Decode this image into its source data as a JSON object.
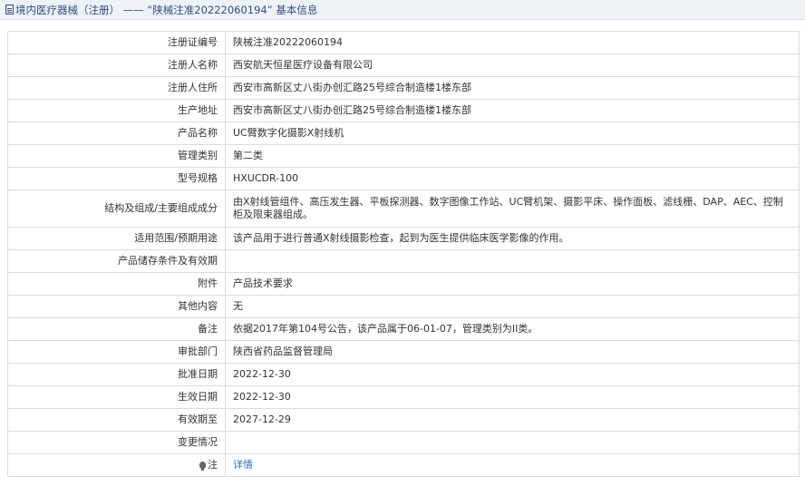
{
  "header": {
    "title": "境内医疗器械（注册） —— “陕械注准20222060194” 基本信息"
  },
  "rows": [
    {
      "label": "注册证编号",
      "value": "陕械注准20222060194"
    },
    {
      "label": "注册人名称",
      "value": "西安航天恒星医疗设备有限公司"
    },
    {
      "label": "注册人住所",
      "value": "西安市高新区丈八街办创汇路25号综合制造楼1楼东部"
    },
    {
      "label": "生产地址",
      "value": "西安市高新区丈八街办创汇路25号综合制造楼1楼东部"
    },
    {
      "label": "产品名称",
      "value": "UC臂数字化摄影X射线机"
    },
    {
      "label": "管理类别",
      "value": "第二类"
    },
    {
      "label": "型号规格",
      "value": "HXUCDR-100"
    },
    {
      "label": "结构及组成/主要组成成分",
      "value": "由X射线管组件、高压发生器、平板探测器、数字图像工作站、UC臂机架、摄影平床、操作面板、滤线栅、DAP、AEC、控制柜及限束器组成。"
    },
    {
      "label": "适用范围/预期用途",
      "value": "该产品用于进行普通X射线摄影检查，起到为医生提供临床医学影像的作用。"
    },
    {
      "label": "产品储存条件及有效期",
      "value": ""
    },
    {
      "label": "附件",
      "value": "产品技术要求"
    },
    {
      "label": "其他内容",
      "value": "无"
    },
    {
      "label": "备注",
      "value": "依据2017年第104号公告，该产品属于06-01-07，管理类别为II类。"
    },
    {
      "label": "审批部门",
      "value": "陕西省药品监督管理局"
    },
    {
      "label": "批准日期",
      "value": "2022-12-30"
    },
    {
      "label": "生效日期",
      "value": "2022-12-30"
    },
    {
      "label": "有效期至",
      "value": "2027-12-29"
    },
    {
      "label": "变更情况",
      "value": ""
    }
  ],
  "note": {
    "icon": "bulb-icon",
    "label": "注",
    "link_text": "详情"
  }
}
